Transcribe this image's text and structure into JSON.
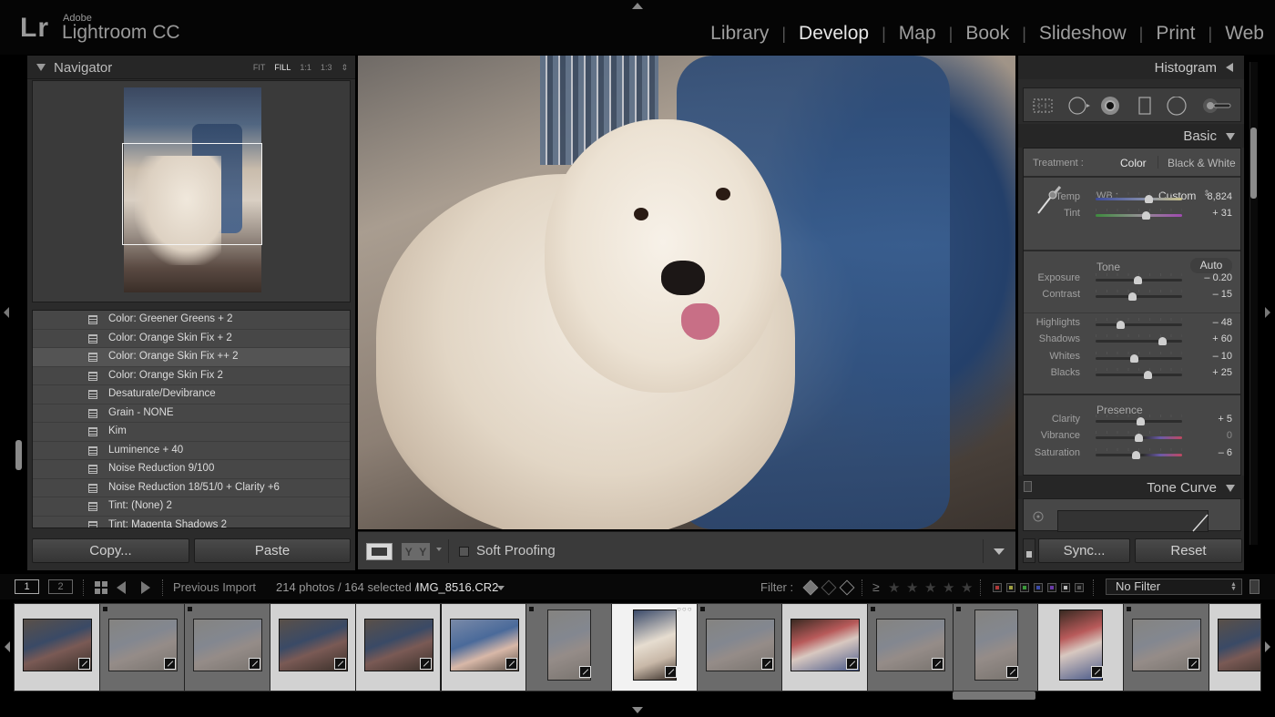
{
  "app": {
    "brand_mark": "Lr",
    "vendor": "Adobe",
    "product": "Lightroom CC"
  },
  "modules": [
    {
      "label": "Library",
      "active": false
    },
    {
      "label": "Develop",
      "active": true
    },
    {
      "label": "Map",
      "active": false
    },
    {
      "label": "Book",
      "active": false
    },
    {
      "label": "Slideshow",
      "active": false
    },
    {
      "label": "Print",
      "active": false
    },
    {
      "label": "Web",
      "active": false
    }
  ],
  "navigator": {
    "title": "Navigator",
    "zoom_options": [
      {
        "label": "FIT",
        "active": false
      },
      {
        "label": "FILL",
        "active": true
      },
      {
        "label": "1:1",
        "active": false
      },
      {
        "label": "1:3",
        "active": false
      }
    ]
  },
  "presets": {
    "items": [
      {
        "label": "Color: Greener Greens + 2",
        "highlighted": false
      },
      {
        "label": "Color: Orange Skin Fix + 2",
        "highlighted": false
      },
      {
        "label": "Color: Orange Skin Fix ++ 2",
        "highlighted": true
      },
      {
        "label": "Color: Orange Skin Fix 2",
        "highlighted": false
      },
      {
        "label": "Desaturate/Devibrance",
        "highlighted": false
      },
      {
        "label": "Grain - NONE",
        "highlighted": false
      },
      {
        "label": "Kim",
        "highlighted": false
      },
      {
        "label": "Luminence + 40",
        "highlighted": false
      },
      {
        "label": "Noise Reduction 9/100",
        "highlighted": false
      },
      {
        "label": "Noise Reduction 18/51/0 + Clarity +6",
        "highlighted": false
      },
      {
        "label": "Tint: (None) 2",
        "highlighted": false
      },
      {
        "label": "Tint: Magenta Shadows 2",
        "highlighted": false
      }
    ]
  },
  "left_buttons": {
    "copy": "Copy...",
    "paste": "Paste"
  },
  "toolbar": {
    "view_compare_label": "Y|Y",
    "soft_proofing_label": "Soft Proofing",
    "soft_proofing_checked": false
  },
  "right_panel": {
    "histogram_title": "Histogram",
    "tools": [
      "crop-overlay-icon",
      "spot-removal-icon",
      "red-eye-icon",
      "graduated-filter-icon",
      "radial-filter-icon",
      "adjustment-brush-icon"
    ],
    "basic_title": "Basic",
    "treatment": {
      "label": "Treatment :",
      "options": [
        {
          "label": "Color",
          "active": true
        },
        {
          "label": "Black & White",
          "active": false
        }
      ]
    },
    "wb": {
      "label": "WB :",
      "value": "Custom"
    },
    "tone_label": "Tone",
    "auto_label": "Auto",
    "presence_label": "Presence",
    "sliders": [
      {
        "id": "temp",
        "label": "Temp",
        "value": "8,824",
        "position": 0.62
      },
      {
        "id": "tint",
        "label": "Tint",
        "value": "+ 31",
        "position": 0.58
      },
      {
        "id": "exposure",
        "label": "Exposure",
        "value": "– 0.20",
        "position": 0.49
      },
      {
        "id": "contrast",
        "label": "Contrast",
        "value": "– 15",
        "position": 0.43
      },
      {
        "id": "highlights",
        "label": "Highlights",
        "value": "– 48",
        "position": 0.29
      },
      {
        "id": "shadows",
        "label": "Shadows",
        "value": "+ 60",
        "position": 0.77
      },
      {
        "id": "whites",
        "label": "Whites",
        "value": "– 10",
        "position": 0.45
      },
      {
        "id": "blacks",
        "label": "Blacks",
        "value": "+ 25",
        "position": 0.61
      },
      {
        "id": "clarity",
        "label": "Clarity",
        "value": "+ 5",
        "position": 0.52
      },
      {
        "id": "vibrance",
        "label": "Vibrance",
        "value": "0",
        "position": 0.5
      },
      {
        "id": "saturation",
        "label": "Saturation",
        "value": "– 6",
        "position": 0.47
      }
    ],
    "tone_curve_title": "Tone Curve",
    "sync_label": "Sync...",
    "reset_label": "Reset"
  },
  "filmstrip_bar": {
    "screen1": "1",
    "screen2": "2",
    "source": "Previous Import",
    "count": "214 photos / 164 selected /",
    "filename": "IMG_8516.CR2",
    "filter_label": "Filter :",
    "gte": "≥",
    "stars": 5,
    "color_labels": [
      "#b03838",
      "#a0a040",
      "#3a9a3a",
      "#3a4aa8",
      "#6a3aa8",
      "#bbbbbb",
      "#555555"
    ],
    "filter_select": "No Filter"
  },
  "filmstrip": {
    "thumbs": [
      {
        "state": "sel",
        "orient": "land",
        "tone": "dark"
      },
      {
        "state": "unsel",
        "orient": "land",
        "tone": "faded"
      },
      {
        "state": "unsel",
        "orient": "land",
        "tone": "faded"
      },
      {
        "state": "sel",
        "orient": "land",
        "tone": "dark"
      },
      {
        "state": "sel",
        "orient": "land",
        "tone": "dark"
      },
      {
        "state": "sel",
        "orient": "land",
        "tone": "family"
      },
      {
        "state": "unsel",
        "orient": "port",
        "tone": "faded"
      },
      {
        "state": "active",
        "orient": "port",
        "tone": "dog"
      },
      {
        "state": "unsel",
        "orient": "land",
        "tone": "faded"
      },
      {
        "state": "sel",
        "orient": "land",
        "tone": "warm"
      },
      {
        "state": "unsel",
        "orient": "land",
        "tone": "faded"
      },
      {
        "state": "unsel",
        "orient": "port",
        "tone": "faded"
      },
      {
        "state": "sel",
        "orient": "port",
        "tone": "warm"
      },
      {
        "state": "unsel",
        "orient": "land",
        "tone": "faded"
      },
      {
        "state": "sel",
        "orient": "land",
        "tone": "dark"
      }
    ]
  }
}
